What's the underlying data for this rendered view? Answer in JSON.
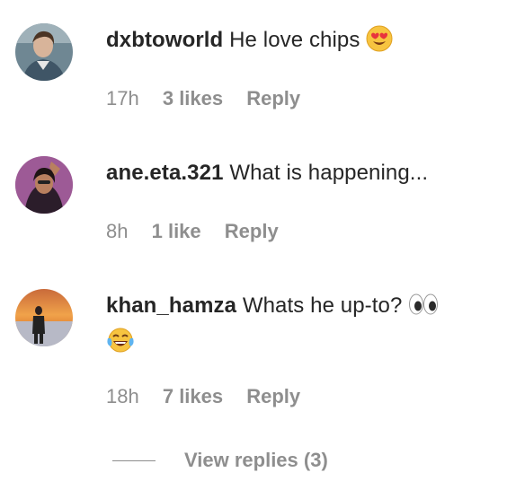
{
  "comments": [
    {
      "username": "dxbtoworld",
      "text": "He love chips",
      "emoji": "heart-eyes",
      "time": "17h",
      "likes": "3 likes",
      "reply": "Reply"
    },
    {
      "username": "ane.eta.321",
      "text": "What is happening...",
      "time": "8h",
      "likes": "1 like",
      "reply": "Reply"
    },
    {
      "username": "khan_hamza",
      "text": "Whats he up-to?",
      "emoji": "eyes",
      "emoji2": "tears-of-joy",
      "time": "18h",
      "likes": "7 likes",
      "reply": "Reply"
    }
  ],
  "view_replies": "View replies (3)"
}
